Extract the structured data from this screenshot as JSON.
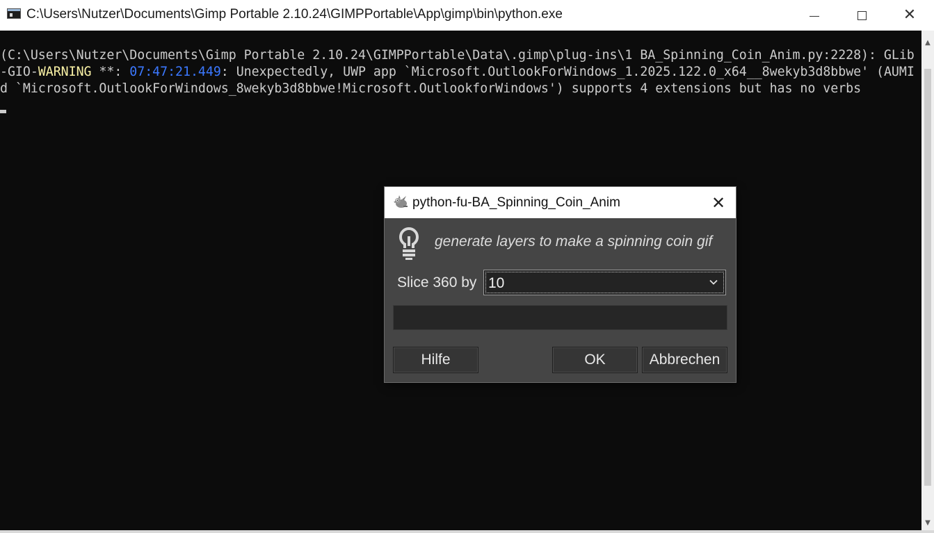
{
  "window": {
    "title": "C:\\Users\\Nutzer\\Documents\\Gimp Portable 2.10.24\\GIMPPortable\\App\\gimp\\bin\\python.exe",
    "icon": "console-app-icon",
    "controls": {
      "minimize": "minimize-icon",
      "maximize": "maximize-icon",
      "close": "close-icon"
    }
  },
  "console": {
    "line1": "(C:\\Users\\Nutzer\\Documents\\Gimp Portable 2.10.24\\GIMPPortable\\Data\\.gimp\\plug-ins\\1 BA_Spinning_Coin_Anim.py:2228): GLib",
    "line2_prefix": "-GIO-",
    "line2_warning": "WARNING",
    "line2_stars": " **: ",
    "line2_timestamp": "07:47:21.449",
    "line2_rest": ": Unexpectedly, UWP app `Microsoft.OutlookForWindows_1.2025.122.0_x64__8wekyb3d8bbwe' (AUMI",
    "line3": "d `Microsoft.OutlookForWindows_8wekyb3d8bbwe!Microsoft.OutlookforWindows') supports 4 extensions but has no verbs",
    "colors": {
      "text": "#cccccc",
      "warning": "#f9f1a5",
      "timestamp": "#3b78ff",
      "background": "#0c0c0c"
    }
  },
  "dialog": {
    "title": "python-fu-BA_Spinning_Coin_Anim",
    "icon": "gimp-wilber-icon",
    "description": "generate layers to make a spinning coin gif",
    "description_icon": "lightbulb-icon",
    "slice_label": "Slice 360 by",
    "slice_value": "10",
    "progress": 0,
    "buttons": {
      "help": "Hilfe",
      "ok": "OK",
      "cancel": "Abbrechen"
    }
  }
}
